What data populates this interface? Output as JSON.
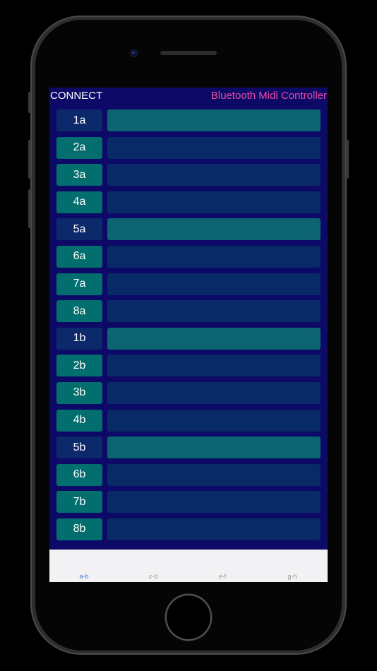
{
  "header": {
    "connect_label": "CONNECT",
    "title": "Bluetooth Midi Controller"
  },
  "rows": [
    {
      "label": "1a",
      "key_color": "navy",
      "bar_color": "teal"
    },
    {
      "label": "2a",
      "key_color": "teal",
      "bar_color": "navy"
    },
    {
      "label": "3a",
      "key_color": "teal",
      "bar_color": "navy"
    },
    {
      "label": "4a",
      "key_color": "teal",
      "bar_color": "navy"
    },
    {
      "label": "5a",
      "key_color": "navy",
      "bar_color": "teal"
    },
    {
      "label": "6a",
      "key_color": "teal",
      "bar_color": "navy"
    },
    {
      "label": "7a",
      "key_color": "teal",
      "bar_color": "navy"
    },
    {
      "label": "8a",
      "key_color": "teal",
      "bar_color": "navy"
    },
    {
      "label": "1b",
      "key_color": "navy",
      "bar_color": "teal"
    },
    {
      "label": "2b",
      "key_color": "teal",
      "bar_color": "navy"
    },
    {
      "label": "3b",
      "key_color": "teal",
      "bar_color": "navy"
    },
    {
      "label": "4b",
      "key_color": "teal",
      "bar_color": "navy"
    },
    {
      "label": "5b",
      "key_color": "navy",
      "bar_color": "teal"
    },
    {
      "label": "6b",
      "key_color": "teal",
      "bar_color": "navy"
    },
    {
      "label": "7b",
      "key_color": "teal",
      "bar_color": "navy"
    },
    {
      "label": "8b",
      "key_color": "teal",
      "bar_color": "navy"
    }
  ],
  "tabs": [
    {
      "label": "a-b",
      "active": true
    },
    {
      "label": "c-d",
      "active": false
    },
    {
      "label": "e-f",
      "active": false
    },
    {
      "label": "g-h",
      "active": false
    }
  ],
  "colors": {
    "background": "#0c0a66",
    "teal": "#036e6e",
    "navy": "#0c2a6b",
    "title_pink": "#e64aa5",
    "tab_active": "#3a7bd5"
  }
}
